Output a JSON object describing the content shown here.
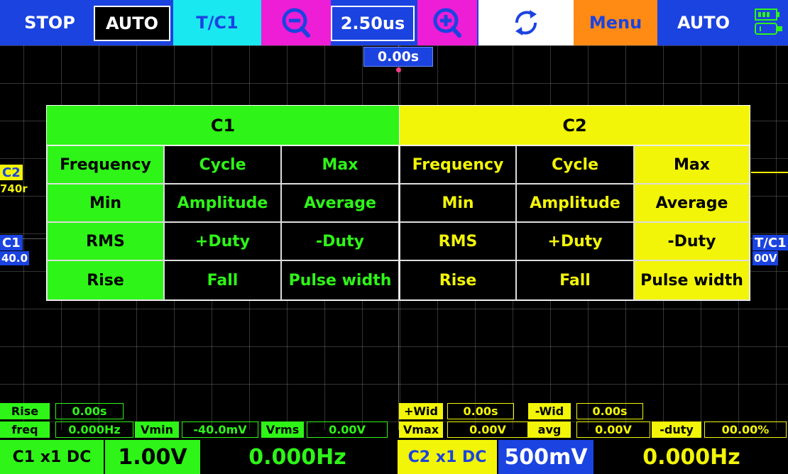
{
  "toolbar": {
    "run_state": "STOP",
    "trigger_mode": "AUTO",
    "trigger_source": "T/C1",
    "timebase": "2.50us",
    "menu": "Menu",
    "auto_button": "AUTO",
    "icons": [
      "zoom-out-icon",
      "zoom-in-icon",
      "refresh-icon",
      "battery-icon"
    ]
  },
  "trigger_time": "0.00s",
  "side": {
    "c2_marker": "C2",
    "c2_value": "740r",
    "c1_marker": "C1",
    "c1_value": "40.0",
    "trig_marker": "T/C1",
    "trig_value": "00V"
  },
  "measure_menu": {
    "c1_header": "C1",
    "c2_header": "C2",
    "c1_rows": [
      [
        "Frequency",
        "Cycle",
        "Max"
      ],
      [
        "Min",
        "Amplitude",
        "Average"
      ],
      [
        "RMS",
        "+Duty",
        "-Duty"
      ],
      [
        "Rise",
        "Fall",
        "Pulse width"
      ]
    ],
    "c2_rows": [
      [
        "Frequency",
        "Cycle",
        "Max"
      ],
      [
        "Min",
        "Amplitude",
        "Average"
      ],
      [
        "RMS",
        "+Duty",
        "-Duty"
      ],
      [
        "Rise",
        "Fall",
        "Pulse width"
      ]
    ]
  },
  "measurements": {
    "rise_label": "Rise",
    "rise_value": "0.00s",
    "freq_label": "freq",
    "freq_value": "0.000Hz",
    "vmin_label": "Vmin",
    "vmin_value": "-40.0mV",
    "vrms_label": "Vrms",
    "vrms_value": "0.00V",
    "pwid_label": "+Wid",
    "pwid_value": "0.00s",
    "nwid_label": "-Wid",
    "nwid_value": "0.00s",
    "vmax_label": "Vmax",
    "vmax_value": "0.00V",
    "avg_label": "avg",
    "avg_value": "0.00V",
    "duty_label": "-duty",
    "duty_value": "00.00%"
  },
  "status_bar": {
    "c1_coupling": "C1 x1 DC",
    "c1_volts": "1.00V",
    "c1_freq": "0.000Hz",
    "c2_coupling": "C2 x1 DC",
    "c2_volts": "500mV",
    "c2_freq": "0.000Hz"
  },
  "colors": {
    "toolbar_blue": "#1b43e0",
    "channel1_green": "#2ef517",
    "channel2_yellow": "#f2f507",
    "magenta": "#ee1dd6",
    "cyan": "#19e8f0",
    "orange": "#ff8a14"
  }
}
